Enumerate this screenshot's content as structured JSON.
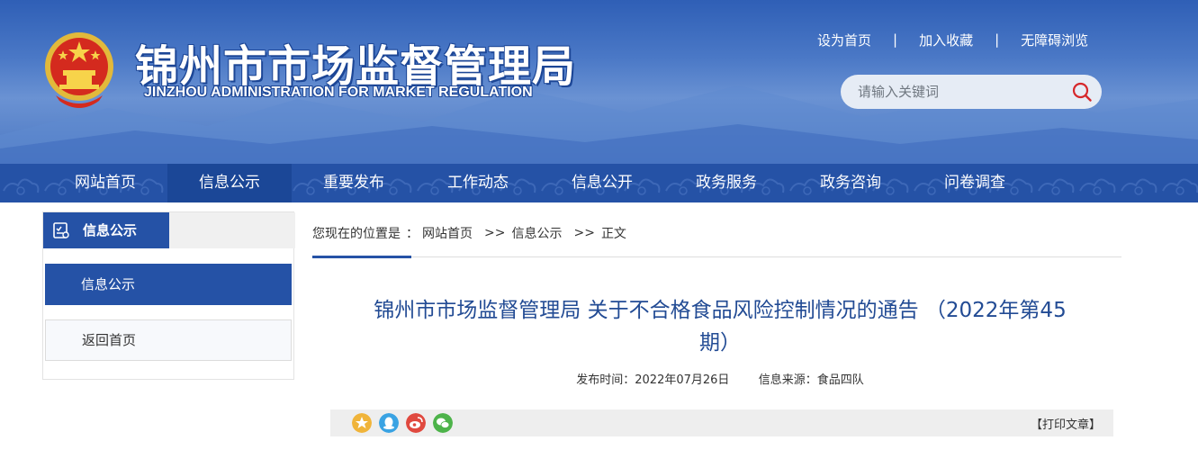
{
  "header": {
    "title": "锦州市市场监督管理局",
    "subtitle": "JINZHOU ADMINISTRATION FOR MARKET REGULATION",
    "emblem_icon": "national-emblem-icon",
    "top_links": [
      "设为首页",
      "加入收藏",
      "无障碍浏览"
    ],
    "separator": "|",
    "search": {
      "placeholder": "请输入关键词",
      "icon": "search-icon"
    }
  },
  "nav": {
    "items": [
      "网站首页",
      "信息公示",
      "重要发布",
      "工作动态",
      "信息公开",
      "政务服务",
      "政务咨询",
      "问卷调查"
    ],
    "active_index": 1
  },
  "sidebar": {
    "heading": "信息公示",
    "heading_icon": "checklist-icon",
    "items": [
      "信息公示",
      "返回首页"
    ],
    "active_index": 0
  },
  "breadcrumb": {
    "label": "您现在的位置是",
    "colon": "：",
    "items": [
      "网站首页",
      "信息公示",
      "正文"
    ],
    "sep": ">>"
  },
  "article": {
    "title": "锦州市市场监督管理局 关于不合格食品风险控制情况的通告 （2022年第45期）",
    "published": "发布时间：2022年07月26日",
    "source": "信息来源：食品四队"
  },
  "share": {
    "icons": [
      "qzone-icon",
      "qq-icon",
      "weibo-icon",
      "wechat-icon"
    ],
    "print_label": "【打印文章】"
  },
  "colors": {
    "primary": "#2552a6",
    "title_text": "#224b94"
  }
}
